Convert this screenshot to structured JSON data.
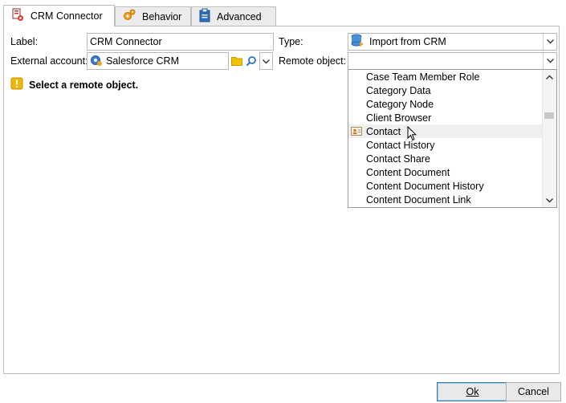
{
  "tabs": [
    {
      "label": "CRM Connector",
      "icon": "crm-connector-icon",
      "active": true
    },
    {
      "label": "Behavior",
      "icon": "gears-icon",
      "active": false
    },
    {
      "label": "Advanced",
      "icon": "clipboard-icon",
      "active": false
    }
  ],
  "form": {
    "label_caption": "Label:",
    "label_value": "CRM Connector",
    "external_account_caption": "External account:",
    "external_account_value": "Salesforce CRM",
    "type_caption": "Type:",
    "type_value": "Import from CRM",
    "remote_object_caption": "Remote object:",
    "remote_object_value": ""
  },
  "warning": {
    "text": "Select a remote object.",
    "icon": "warning-icon"
  },
  "dropdown": {
    "items": [
      "Case Team Member Role",
      "Category Data",
      "Category Node",
      "Client Browser",
      "Contact",
      "Contact History",
      "Contact Share",
      "Content Document",
      "Content Document History",
      "Content Document Link"
    ],
    "hovered_item": "Contact"
  },
  "footer": {
    "ok_label": "Ok",
    "cancel_label": "Cancel"
  },
  "colors": {
    "accent": "#3c7fb1",
    "warning": "#f2b705",
    "folder": "#f2c200"
  }
}
